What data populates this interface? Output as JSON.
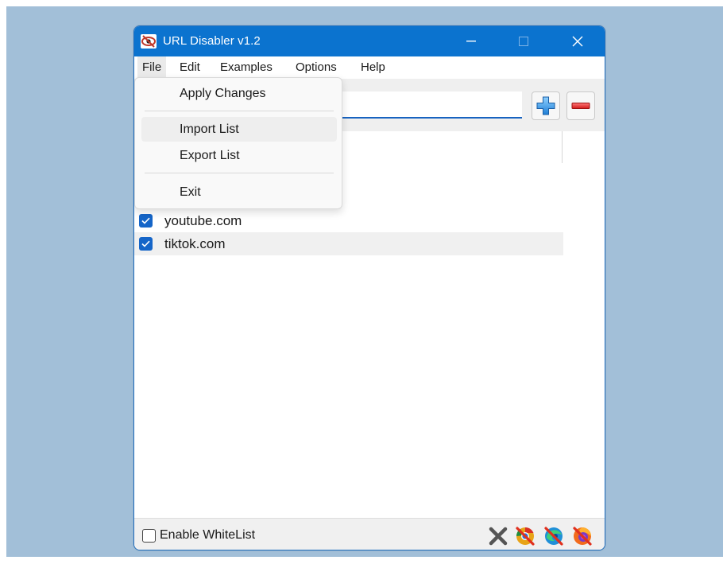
{
  "window": {
    "title": "URL Disabler v1.2",
    "accent": "#0b73cf"
  },
  "menubar": {
    "items": [
      {
        "label": "File"
      },
      {
        "label": "Edit"
      },
      {
        "label": "Examples"
      },
      {
        "label": "Options"
      },
      {
        "label": "Help"
      }
    ],
    "open_menu": "File"
  },
  "file_menu": {
    "items": [
      {
        "label": "Apply Changes"
      },
      {
        "label": "Import List"
      },
      {
        "label": "Export List"
      },
      {
        "label": "Exit"
      }
    ],
    "hovered": "Import List"
  },
  "toolbar": {
    "url_value": "",
    "url_placeholder": "",
    "add_icon": "plus-icon",
    "remove_icon": "minus-icon"
  },
  "url_list": [
    {
      "url": "youtube.com",
      "checked": true
    },
    {
      "url": "tiktok.com",
      "checked": true,
      "selected": true
    }
  ],
  "statusbar": {
    "whitelist_label": "Enable WhiteList",
    "whitelist_checked": false,
    "icons": [
      "close-x-icon",
      "chrome-blocked-icon",
      "edge-blocked-icon",
      "firefox-blocked-icon"
    ]
  }
}
